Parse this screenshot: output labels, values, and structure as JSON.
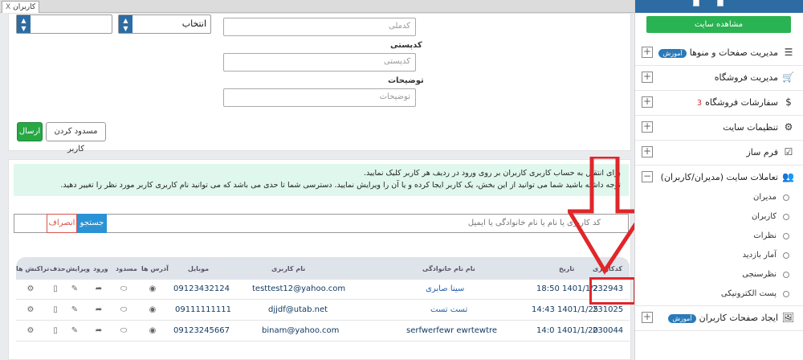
{
  "tab": {
    "label": "کاربران",
    "close": "X"
  },
  "form": {
    "select_left_value": "",
    "select_role_value": "انتخاب",
    "national_code_placeholder": "کدملی",
    "postal_label": "کدپستی",
    "postal_placeholder": "کدپستی",
    "description_label": "توضیحات",
    "description_placeholder": "توضیحات",
    "submit_label": "ارسال",
    "block_label": "مسدود کردن کاربر"
  },
  "alert": {
    "line1": "برای انتقال به حساب کاربری کاربران بر روی ورود در ردیف هر کاربر کلیک نمایید.",
    "line2": "توجه داشته باشید شما می توانید از این بخش، یک کاربر ایجا کرده و یا آن را ویرایش نمایید. دسترسی شما تا حدی می باشد که می توانید نام کاربری کاربر مورد نظر را تغییر دهید."
  },
  "search": {
    "placeholder": "کد کاربری یا نام یا نام خانوادگی یا ایمیل",
    "search_label": "جستجو",
    "cancel_label": "انصراف"
  },
  "table": {
    "headers": {
      "code": "کدکاربری",
      "date": "تاریخ",
      "name": "نام نام خانوادگی",
      "username": "نام کاربری",
      "mobile": "موبایل",
      "addresses": "آدرس ها",
      "blocked": "مسدود",
      "login": "ورود",
      "edit": "ویرایش",
      "delete": "حذف",
      "transactions": "تراکنش ها"
    },
    "rows": [
      {
        "code": "232943",
        "date": "18:50 1401/1/2",
        "name": "سینا صابری",
        "username": "testtest12@yahoo.com",
        "mobile": "09123432124"
      },
      {
        "code": "231025",
        "date": "14:43 1401/1/25",
        "name": "تست تست",
        "username": "djjdf@utab.net",
        "mobile": "09111111111"
      },
      {
        "code": "230044",
        "date": "14:0 1401/1/20",
        "name": "serfwerfewr ewrtewtre",
        "username": "binam@yahoo.com",
        "mobile": "09123245667"
      }
    ]
  },
  "sidebar": {
    "top_mini_left": "",
    "top_mini_right": "",
    "view_site": "مشاهده سایت",
    "items": [
      {
        "label": "مدیریت صفحات و منوها",
        "badge": "آموزش",
        "icon": "pages-icon"
      },
      {
        "label": "مدیریت فروشگاه",
        "badge": "",
        "icon": "cart-icon"
      },
      {
        "label": "سفارشات فروشگاه",
        "badge": "",
        "icon": "dollar-icon",
        "bell": "3"
      },
      {
        "label": "تنظیمات سایت",
        "badge": "",
        "icon": "gear-icon"
      },
      {
        "label": "فرم ساز",
        "badge": "",
        "icon": "checkbox-icon"
      },
      {
        "label": "تعاملات سایت (مدیران/کاربران)",
        "badge": "",
        "icon": "users-icon"
      }
    ],
    "sub_items": [
      "مدیران",
      "کاربران",
      "نظرات",
      "آمار بازدید",
      "نظرسنجی",
      "پست الکترونیکی"
    ],
    "last_item": {
      "label": "ایجاد صفحات کاربران",
      "badge": "آموزش",
      "icon": "image-icon"
    }
  },
  "colors": {
    "primary": "#2d6ca2",
    "green": "#28a745",
    "highlight": "#e0262a",
    "alert_bg": "#dff7ec"
  }
}
